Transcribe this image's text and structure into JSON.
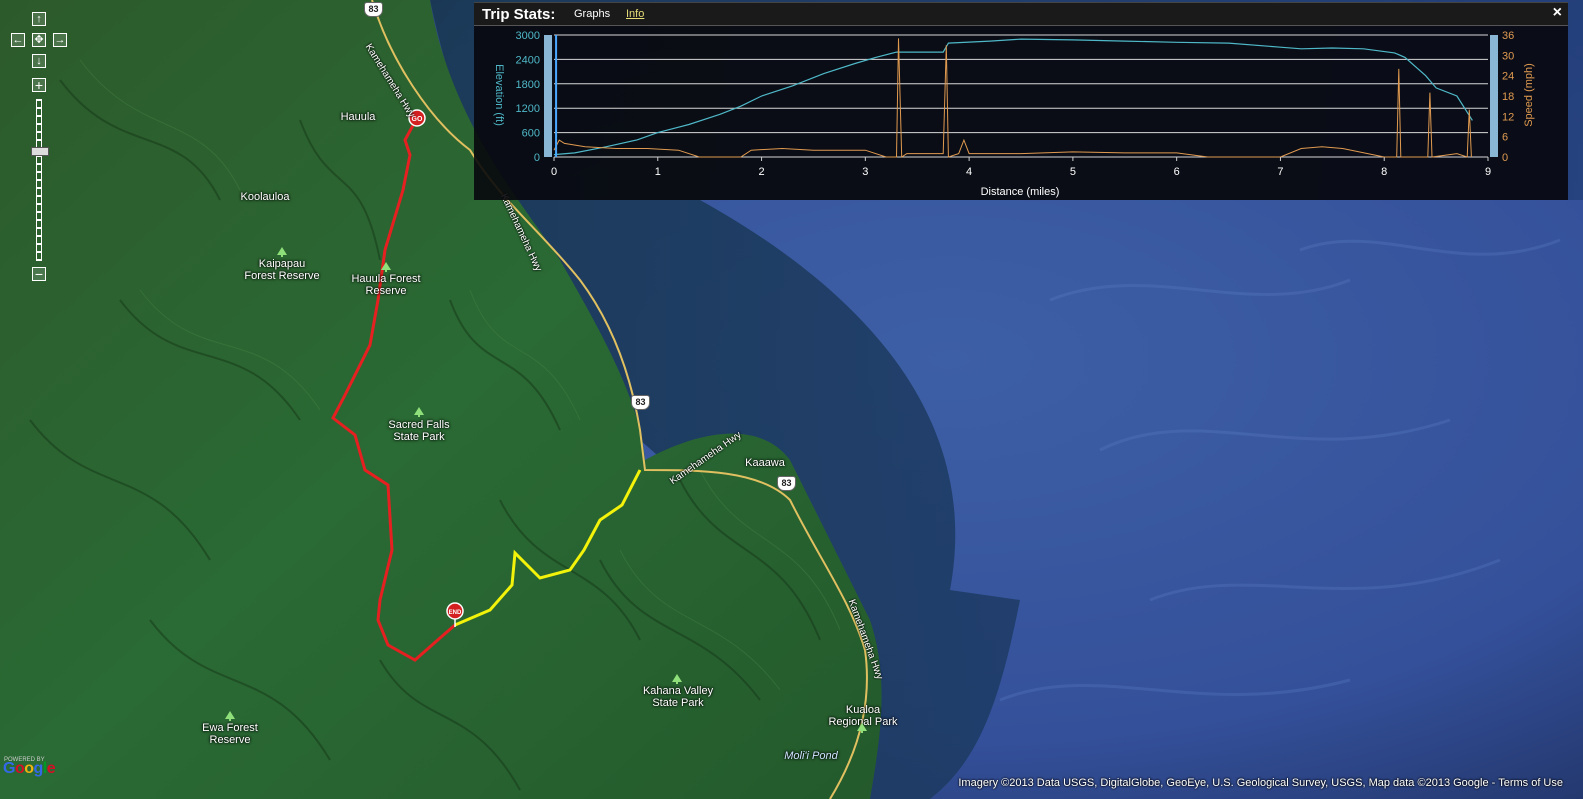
{
  "map": {
    "labels": [
      {
        "id": "hauula",
        "text": "Hauula"
      },
      {
        "id": "koolauloa",
        "text": "Koolauloa"
      },
      {
        "id": "kaipapau",
        "text": "Kaipapau\nForest Reserve"
      },
      {
        "id": "hauula-forest",
        "text": "Hauula Forest\nReserve"
      },
      {
        "id": "sacred-falls",
        "text": "Sacred Falls\nState Park"
      },
      {
        "id": "kaaawa",
        "text": "Kaaawa"
      },
      {
        "id": "kahana-valley",
        "text": "Kahana Valley\nState Park"
      },
      {
        "id": "kualoa",
        "text": "Kualoa\nRegional Park"
      },
      {
        "id": "ewa-forest",
        "text": "Ewa Forest\nReserve"
      },
      {
        "id": "molii-pond",
        "text": "Moli'i Pond"
      }
    ],
    "highway_label": "Kamehameha Hwy",
    "route_shield": "83",
    "start_marker": "GO",
    "end_marker": "END",
    "route_colors": {
      "red": "#e62020",
      "yellow": "#f2f20a"
    }
  },
  "nav": {
    "up": "↑",
    "down": "↓",
    "left": "←",
    "right": "→",
    "center": "✥",
    "zoom_in": "+",
    "zoom_out": "−"
  },
  "stats": {
    "title": "Trip Stats:",
    "tab_graphs": "Graphs",
    "tab_info": "Info",
    "close": "×"
  },
  "chart_data": {
    "type": "line",
    "xlabel": "Distance (miles)",
    "ylabel_left": "Elevation (ft)",
    "ylabel_right": "Speed (mph)",
    "x_ticks": [
      0,
      1,
      2,
      3,
      4,
      5,
      6,
      7,
      8,
      9
    ],
    "y_left_ticks": [
      0,
      600,
      1200,
      1800,
      2400,
      3000
    ],
    "y_right_ticks": [
      0,
      6,
      12,
      18,
      24,
      30,
      36
    ],
    "xlim": [
      0,
      9
    ],
    "ylim_left": [
      0,
      3000
    ],
    "ylim_right": [
      0,
      36
    ],
    "grid": true,
    "series": [
      {
        "name": "Elevation (ft)",
        "color": "#4fb8c8",
        "x": [
          0,
          0.2,
          0.5,
          0.8,
          1.0,
          1.3,
          1.6,
          1.8,
          2.0,
          2.3,
          2.6,
          2.9,
          3.1,
          3.3,
          3.5,
          3.75,
          3.8,
          4.2,
          4.5,
          5.0,
          5.5,
          6.0,
          6.5,
          7.0,
          7.2,
          7.5,
          7.8,
          8.1,
          8.2,
          8.4,
          8.5,
          8.7,
          8.85
        ],
        "values": [
          60,
          100,
          250,
          420,
          600,
          800,
          1050,
          1250,
          1500,
          1750,
          2050,
          2300,
          2450,
          2580,
          2580,
          2580,
          2800,
          2850,
          2900,
          2880,
          2850,
          2820,
          2800,
          2700,
          2660,
          2680,
          2660,
          2560,
          2450,
          2000,
          1700,
          1500,
          900
        ]
      },
      {
        "name": "Speed (mph)",
        "color": "#e09a50",
        "x": [
          0.0,
          0.05,
          0.1,
          0.3,
          0.6,
          0.9,
          1.2,
          1.4,
          1.5,
          1.8,
          1.9,
          2.2,
          2.5,
          2.8,
          3.0,
          3.2,
          3.3,
          3.32,
          3.35,
          3.4,
          3.75,
          3.78,
          3.8,
          3.9,
          3.95,
          4.0,
          4.5,
          5.0,
          5.5,
          6.0,
          6.3,
          7.0,
          7.2,
          7.4,
          7.6,
          8.0,
          8.12,
          8.14,
          8.16,
          8.3,
          8.42,
          8.44,
          8.46,
          8.7,
          8.8,
          8.82,
          8.84
        ],
        "values": [
          2,
          5,
          4,
          3,
          2.5,
          2.5,
          2,
          0,
          0,
          0,
          2,
          2.5,
          2,
          2,
          2,
          0,
          0,
          35,
          0,
          1,
          1,
          33,
          0,
          1,
          5,
          1,
          1,
          1.5,
          1.2,
          1.2,
          0,
          0,
          2.5,
          3,
          2.5,
          0,
          0,
          26,
          0,
          0,
          0,
          19,
          0,
          1,
          0,
          14,
          0
        ]
      }
    ]
  },
  "attribution": {
    "imagery": "Imagery ©2013",
    "data": "Data USGS, DigitalGlobe, GeoEye, U.S. Geological Survey, USGS, Map data ©2013",
    "google": "Google",
    "sep": "-",
    "terms": "Terms of Use"
  },
  "google_logo": {
    "powered": "POWERED BY",
    "text": "Google"
  }
}
